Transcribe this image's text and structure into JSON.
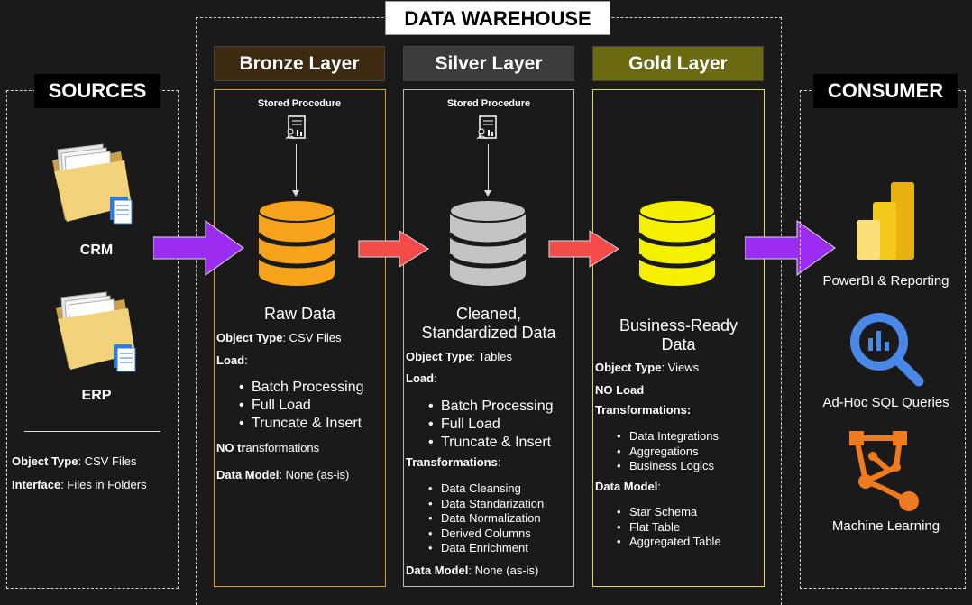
{
  "warehouse": {
    "title": "DATA WAREHOUSE"
  },
  "sources": {
    "title": "SOURCES",
    "items": [
      {
        "label": "CRM"
      },
      {
        "label": "ERP"
      }
    ],
    "object_type_label": "Object Type",
    "object_type_value": ": CSV Files",
    "interface_label": "Interface",
    "interface_value": ": Files in Folders"
  },
  "bronze": {
    "header": "Bronze Layer",
    "procedure": "Stored Procedure",
    "name": "Raw Data",
    "object_type_label": "Object Type",
    "object_type_value": ": CSV Files",
    "load_label": "Load",
    "load_items": [
      "Batch Processing",
      "Full Load",
      "Truncate & Insert"
    ],
    "no_transform_bold_1": "NO",
    "no_transform_bold_2": "tr",
    "no_transform_rest": "ansformations",
    "data_model_label": "Data Model",
    "data_model_value": ": None (as-is)",
    "color": "#f7a21b"
  },
  "silver": {
    "header": "Silver Layer",
    "procedure": "Stored Procedure",
    "name_line1": "Cleaned,",
    "name_line2": "Standardized Data",
    "object_type_label": "Object Type",
    "object_type_value": ": Tables",
    "load_label": "Load",
    "load_items": [
      "Batch Processing",
      "Full Load",
      "Truncate & Insert"
    ],
    "transform_label": "Transformations",
    "transform_items": [
      "Data Cleansing",
      "Data Standarization",
      "Data Normalization",
      "Derived Columns",
      "Data Enrichment"
    ],
    "data_model_label": "Data Model",
    "data_model_value": ": None (as-is)",
    "color": "#c4c4c4"
  },
  "gold": {
    "header": "Gold Layer",
    "name_line1": "Business-Ready",
    "name_line2": "Data",
    "object_type_label": "Object Type",
    "object_type_value": ": Views",
    "no_load": "NO Load",
    "transform_label": "Transformations:",
    "transform_items": [
      "Data Integrations",
      "Aggregations",
      "Business Logics"
    ],
    "data_model_label": "Data Model",
    "data_model_items": [
      "Star Schema",
      "Flat Table",
      "Aggregated Table"
    ],
    "color": "#f5ef00"
  },
  "consumer": {
    "title": "CONSUMER",
    "items": [
      {
        "label": "PowerBI & Reporting"
      },
      {
        "label": "Ad-Hoc SQL Queries"
      },
      {
        "label": "Machine Learning"
      }
    ]
  },
  "colors": {
    "purple_arrow": "#9b2cf0",
    "red_arrow": "#f44a4a",
    "bronze_head_bg": "#3d2a10",
    "silver_head_bg": "#3c3c3c",
    "gold_head_bg": "#6b6a10"
  }
}
